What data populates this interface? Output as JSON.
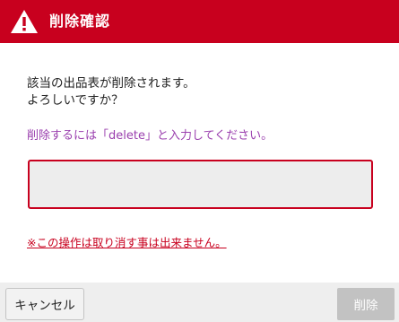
{
  "dialog": {
    "title": "削除確認",
    "message_line1": "該当の出品表が削除されます。",
    "message_line2": "よろしいですか？",
    "instruction": "削除するには「delete」と入力してください。",
    "input_value": "",
    "input_placeholder": "",
    "warning": "※この操作は取り消す事は出来ません。",
    "cancel_label": "キャンセル",
    "delete_label": "削除"
  },
  "icons": {
    "header_icon": "warning-triangle-icon"
  },
  "colors": {
    "header_bg": "#c8001e",
    "instruction_text": "#9a3fae",
    "warning_text": "#c8001e",
    "input_border": "#c8001e",
    "delete_button_disabled": "#c2c2c2",
    "footer_bg": "#eeeeee"
  }
}
